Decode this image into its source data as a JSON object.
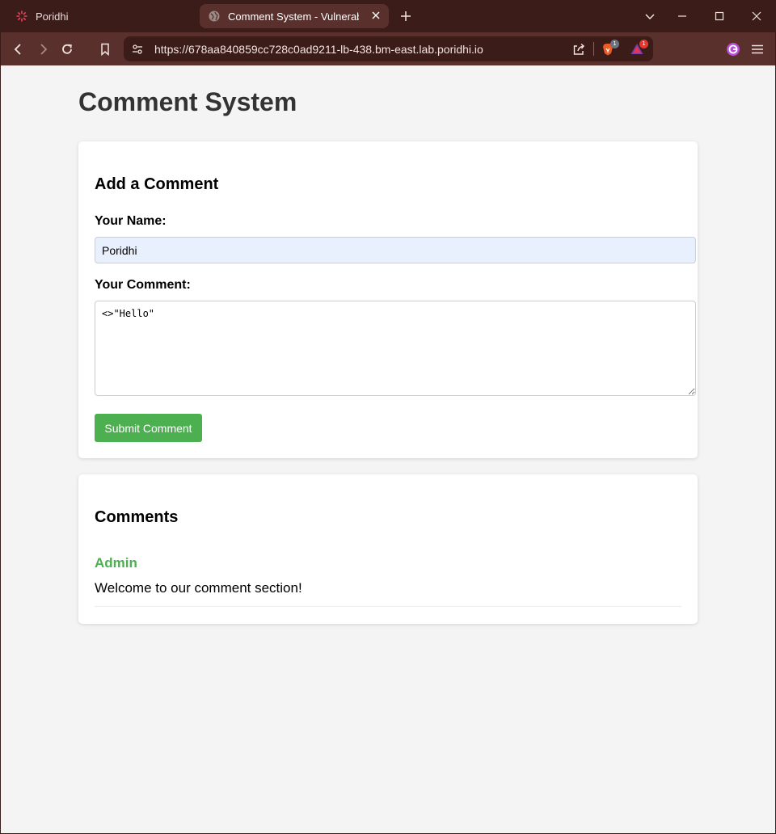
{
  "browser": {
    "tabs": [
      {
        "title": "Poridhi",
        "active": false
      },
      {
        "title": "Comment System - Vulnerable",
        "active": true
      }
    ],
    "url": "https://678aa840859cc728c0ad9211-lb-438.bm-east.lab.poridhi.io",
    "brave_shield_count": "1",
    "rewards_count": "1",
    "colors": {
      "tabstrip": "#3c1c19",
      "toolbar": "#5a302c",
      "accent": "#4caf50"
    }
  },
  "page": {
    "title": "Comment System",
    "form": {
      "heading": "Add a Comment",
      "name_label": "Your Name:",
      "name_value": "Poridhi",
      "comment_label": "Your Comment:",
      "comment_value": "<>\"Hello\"",
      "submit_label": "Submit Comment"
    },
    "comments": {
      "heading": "Comments",
      "items": [
        {
          "author": "Admin",
          "text": "Welcome to our comment section!"
        }
      ]
    }
  }
}
